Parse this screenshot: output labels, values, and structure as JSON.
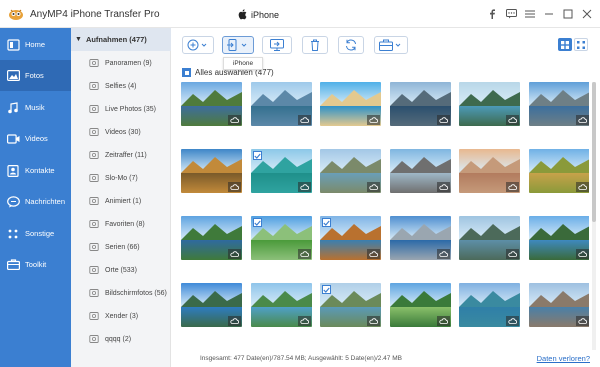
{
  "app": {
    "title": "AnyMP4 iPhone Transfer Pro",
    "device": "iPhone"
  },
  "sidebar": {
    "items": [
      {
        "label": "Home",
        "icon": "home-icon"
      },
      {
        "label": "Fotos",
        "icon": "photos-icon",
        "active": true
      },
      {
        "label": "Musik",
        "icon": "music-icon"
      },
      {
        "label": "Videos",
        "icon": "video-icon"
      },
      {
        "label": "Kontakte",
        "icon": "contacts-icon"
      },
      {
        "label": "Nachrichten",
        "icon": "messages-icon"
      },
      {
        "label": "Sonstige",
        "icon": "more-icon"
      },
      {
        "label": "Toolkit",
        "icon": "toolkit-icon"
      }
    ]
  },
  "albums": {
    "header": "Aufnahmen (477)",
    "items": [
      {
        "label": "Panoramen (9)"
      },
      {
        "label": "Selfies (4)"
      },
      {
        "label": "Live Photos (35)"
      },
      {
        "label": "Videos (30)"
      },
      {
        "label": "Zeitraffer (11)"
      },
      {
        "label": "Slo-Mo (7)"
      },
      {
        "label": "Animiert (1)"
      },
      {
        "label": "Favoriten (8)"
      },
      {
        "label": "Serien (66)"
      },
      {
        "label": "Orte (533)"
      },
      {
        "label": "Bildschirmfotos (56)"
      },
      {
        "label": "Xender (3)"
      },
      {
        "label": "qqqq (2)"
      }
    ]
  },
  "toolbar": {
    "tooltip": "iPhone"
  },
  "select_all": {
    "label": "Alles auswählen (477)"
  },
  "status": {
    "text": "Insgesamt: 477 Date(en)/787.54 MB; Ausgewählt: 5 Date(en)/2.47 MB",
    "link": "Daten verloren?"
  },
  "colors": {
    "sidebar": "#3b7fd1",
    "sidebar_active": "#2f6ab5",
    "accent": "#3b7fd1"
  }
}
